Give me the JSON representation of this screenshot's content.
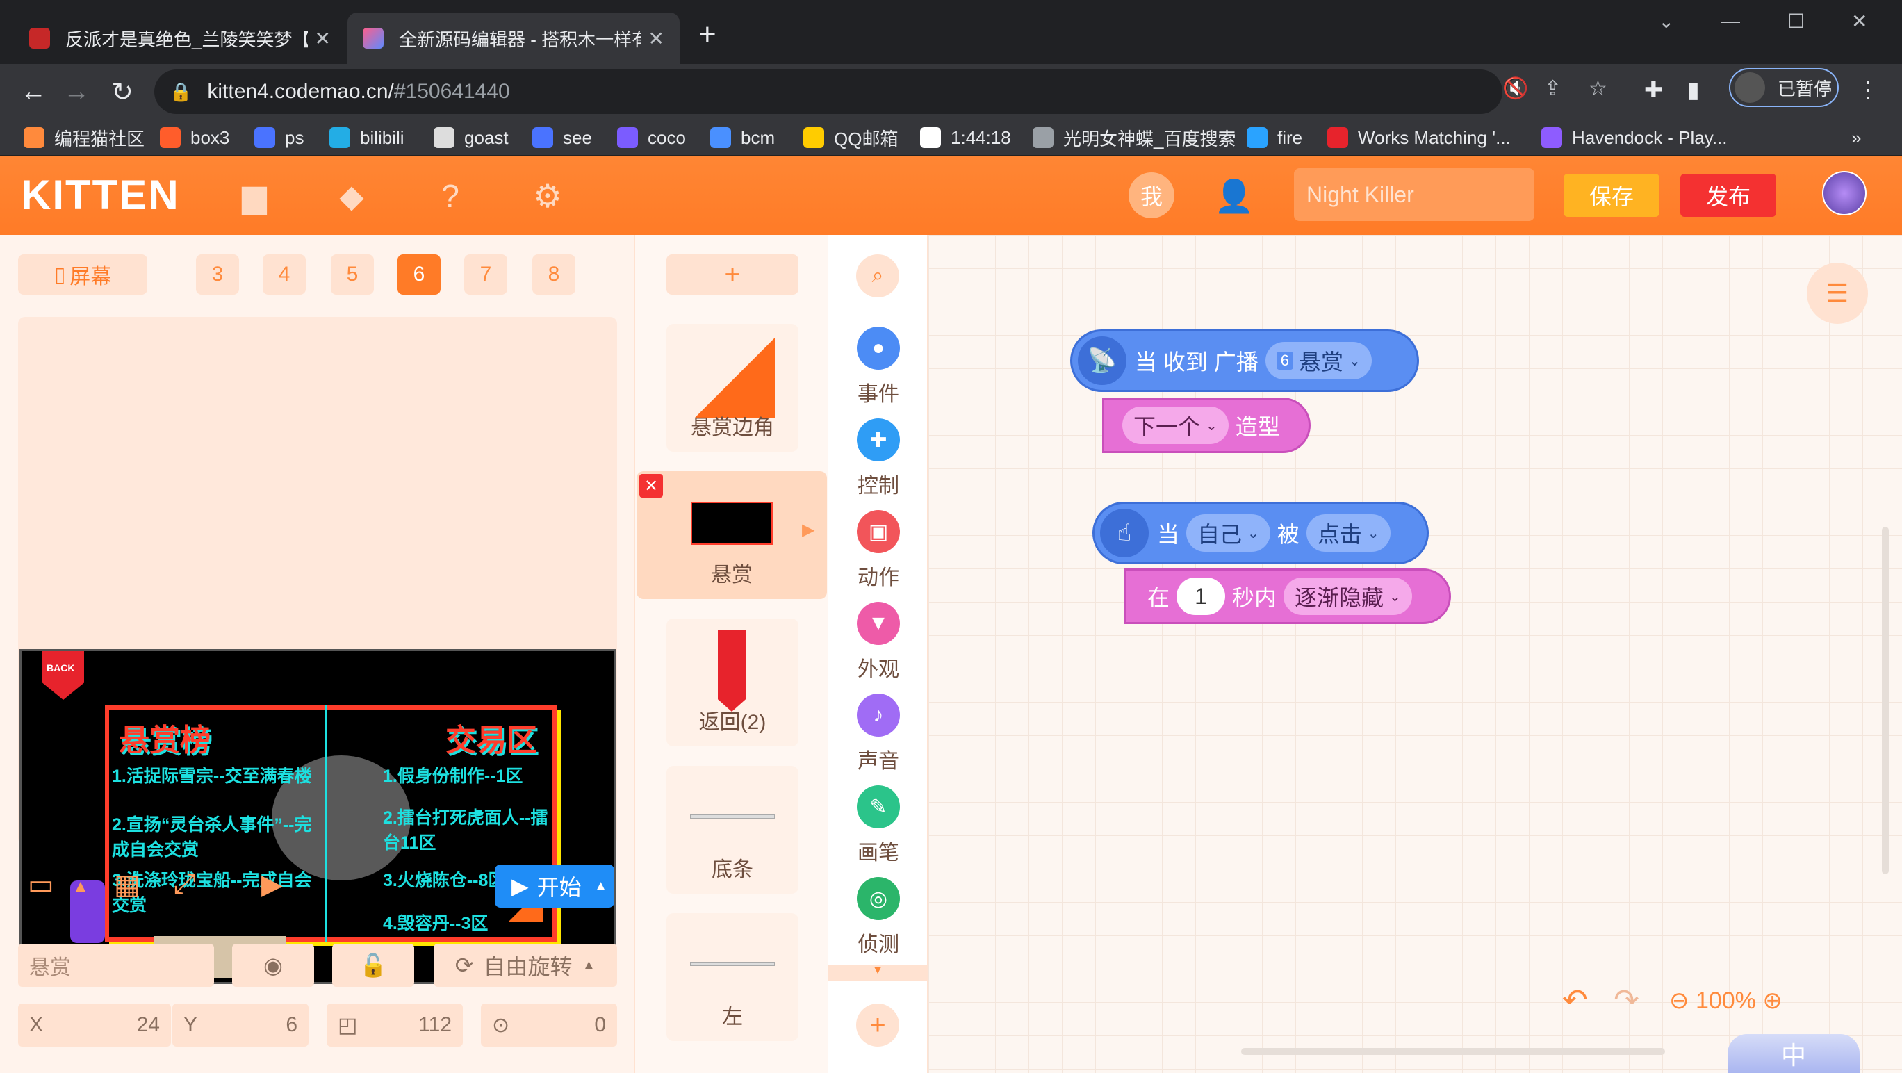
{
  "browser": {
    "tabs": [
      {
        "title": "反派才是真绝色_兰陵笑笑梦【完"
      },
      {
        "title": "全新源码编辑器 - 搭积木一样有趣"
      }
    ],
    "url_host": "kitten4.codemao.cn/",
    "url_path": "#150641440",
    "profile_label": "已暂停",
    "bookmarks": [
      {
        "label": "编程猫社区",
        "color": "#ff8a3c"
      },
      {
        "label": "box3",
        "color": "#ff5d2b"
      },
      {
        "label": "ps",
        "color": "#4a73ff"
      },
      {
        "label": "bilibili",
        "color": "#23ade5"
      },
      {
        "label": "goast",
        "color": "#dddddd"
      },
      {
        "label": "see",
        "color": "#4a73ff"
      },
      {
        "label": "coco",
        "color": "#7b5cff"
      },
      {
        "label": "bcm",
        "color": "#4a90ff"
      },
      {
        "label": "QQ邮箱",
        "color": "#ffcc00"
      },
      {
        "label": "1:44:18",
        "color": "#ffffff"
      },
      {
        "label": "光明女神蝶_百度搜索",
        "color": "#9aa0a6"
      },
      {
        "label": "fire",
        "color": "#2aa3ff"
      },
      {
        "label": "Works Matching '...",
        "color": "#e7232c"
      },
      {
        "label": "Havendock - Play...",
        "color": "#8e5cff"
      }
    ],
    "more_label": "»"
  },
  "app": {
    "logo": "KITTEN",
    "me_label": "我",
    "project_name": "Night Killer",
    "save_label": "保存",
    "publish_label": "发布"
  },
  "stage": {
    "screen_label": "屏幕",
    "pages": [
      "3",
      "4",
      "5",
      "6",
      "7",
      "8"
    ],
    "current_page": "6",
    "start_label": "开始",
    "board": {
      "back": "BACK",
      "left_title": "悬赏榜",
      "right_title": "交易区",
      "left_items": [
        "1.活捉际雪宗--交至满春楼",
        "2.宣扬“灵台杀人事件”--完成自会交赏",
        "3.洗涤玲珑宝船--完成自会交赏"
      ],
      "right_items": [
        "1.假身份制作--1区",
        "2.擂台打死虎面人--擂台11区",
        "3.火烧陈仓--8区",
        "4.毁容丹--3区"
      ]
    },
    "sprite_name": "悬赏",
    "rotation_label": "自由旋转",
    "x_label": "X",
    "x": "24",
    "y_label": "Y",
    "y": "6",
    "size": "112",
    "rotation": "0"
  },
  "sprites": [
    {
      "label": "悬赏边角"
    },
    {
      "label": "悬赏"
    },
    {
      "label": "返回(2)"
    },
    {
      "label": "底条"
    },
    {
      "label": "左"
    }
  ],
  "categories": [
    {
      "label": "事件",
      "color": "#4c8cf5"
    },
    {
      "label": "控制",
      "color": "#2f9df5"
    },
    {
      "label": "动作",
      "color": "#f2555a"
    },
    {
      "label": "外观",
      "color": "#ee5ba8"
    },
    {
      "label": "声音",
      "color": "#a06cf5"
    },
    {
      "label": "画笔",
      "color": "#2bc48a"
    },
    {
      "label": "侦测",
      "color": "#2bb56a"
    }
  ],
  "blocks": {
    "b1": {
      "when": "当 收到 广播",
      "badge": "6",
      "msg": "悬赏",
      "next": "下一个",
      "costume": "造型"
    },
    "b2": {
      "when": "当",
      "target": "自己",
      "was": "被",
      "action": "点击",
      "in": "在",
      "secs": "1",
      "within": "秒内",
      "effect": "逐渐隐藏"
    }
  },
  "workspace": {
    "zoom": "100%",
    "bottom_btn": "中"
  }
}
